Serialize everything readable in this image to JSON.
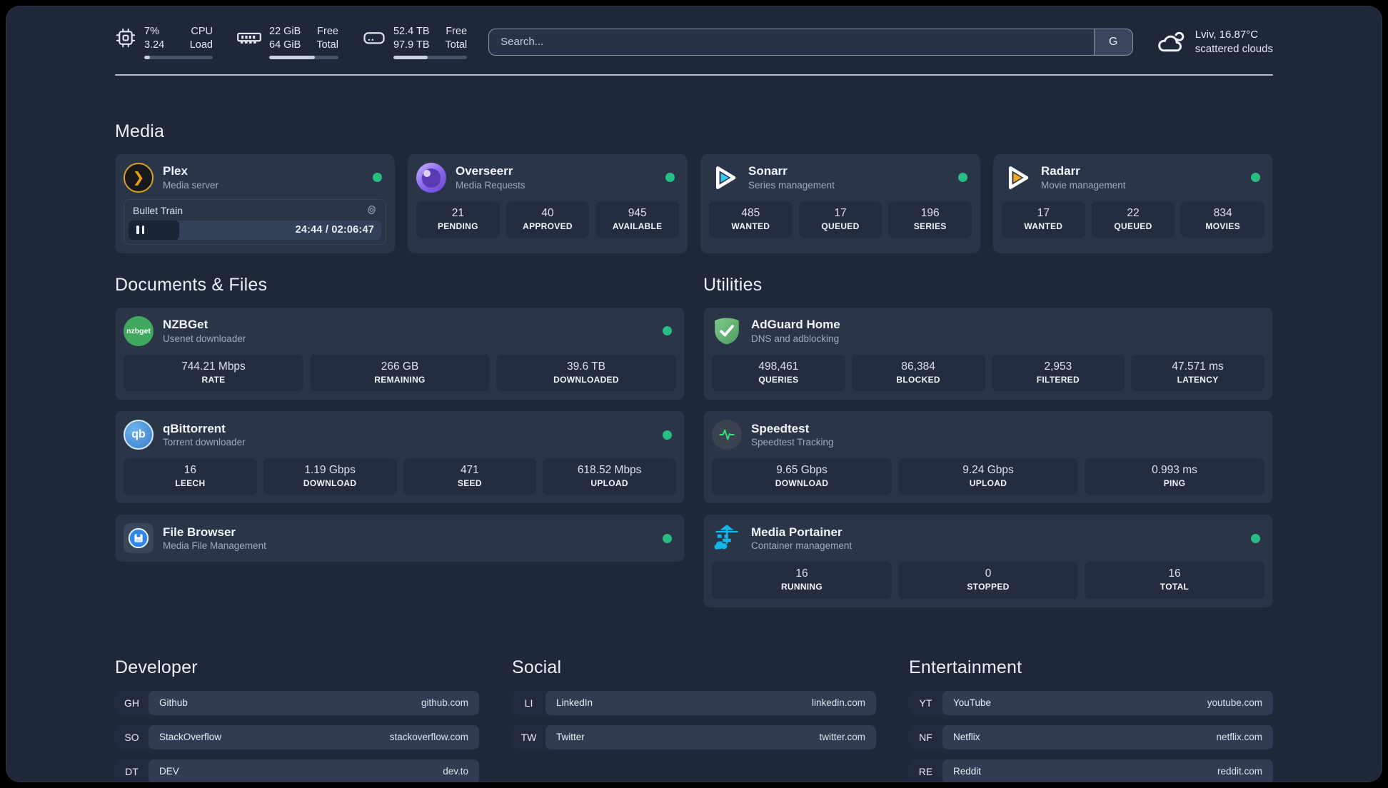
{
  "topbar": {
    "cpu": {
      "pct": "7%",
      "load": "3.24",
      "label_top": "CPU",
      "label_bottom": "Load",
      "progress": 8
    },
    "memory": {
      "free": "22 GiB",
      "total": "64 GiB",
      "label_top": "Free",
      "label_bottom": "Total",
      "progress": 66
    },
    "disk": {
      "free": "52.4 TB",
      "total": "97.9 TB",
      "label_top": "Free",
      "label_bottom": "Total",
      "progress": 47
    },
    "search": {
      "placeholder": "Search...",
      "button": "G"
    },
    "weather": {
      "line1": "Lviv, 16.87°C",
      "line2": "scattered clouds"
    }
  },
  "media": {
    "title": "Media",
    "plex": {
      "title": "Plex",
      "subtitle": "Media server",
      "now_playing": "Bullet Train",
      "time": "24:44 / 02:06:47",
      "progress": 20
    },
    "overseerr": {
      "title": "Overseerr",
      "subtitle": "Media Requests",
      "stats": [
        {
          "value": "21",
          "label": "PENDING"
        },
        {
          "value": "40",
          "label": "APPROVED"
        },
        {
          "value": "945",
          "label": "AVAILABLE"
        }
      ]
    },
    "sonarr": {
      "title": "Sonarr",
      "subtitle": "Series management",
      "stats": [
        {
          "value": "485",
          "label": "WANTED"
        },
        {
          "value": "17",
          "label": "QUEUED"
        },
        {
          "value": "196",
          "label": "SERIES"
        }
      ]
    },
    "radarr": {
      "title": "Radarr",
      "subtitle": "Movie management",
      "stats": [
        {
          "value": "17",
          "label": "WANTED"
        },
        {
          "value": "22",
          "label": "QUEUED"
        },
        {
          "value": "834",
          "label": "MOVIES"
        }
      ]
    }
  },
  "documents": {
    "title": "Documents & Files",
    "nzbget": {
      "title": "NZBGet",
      "subtitle": "Usenet downloader",
      "icon_text": "nzbget",
      "stats": [
        {
          "value": "744.21 Mbps",
          "label": "RATE"
        },
        {
          "value": "266 GB",
          "label": "REMAINING"
        },
        {
          "value": "39.6 TB",
          "label": "DOWNLOADED"
        }
      ]
    },
    "qbittorrent": {
      "title": "qBittorrent",
      "subtitle": "Torrent downloader",
      "icon_text": "qb",
      "stats": [
        {
          "value": "16",
          "label": "LEECH"
        },
        {
          "value": "1.19 Gbps",
          "label": "DOWNLOAD"
        },
        {
          "value": "471",
          "label": "SEED"
        },
        {
          "value": "618.52 Mbps",
          "label": "UPLOAD"
        }
      ]
    },
    "filebrowser": {
      "title": "File Browser",
      "subtitle": "Media File Management"
    }
  },
  "utilities": {
    "title": "Utilities",
    "adguard": {
      "title": "AdGuard Home",
      "subtitle": "DNS and adblocking",
      "stats": [
        {
          "value": "498,461",
          "label": "QUERIES"
        },
        {
          "value": "86,384",
          "label": "BLOCKED"
        },
        {
          "value": "2,953",
          "label": "FILTERED"
        },
        {
          "value": "47.571 ms",
          "label": "LATENCY"
        }
      ]
    },
    "speedtest": {
      "title": "Speedtest",
      "subtitle": "Speedtest Tracking",
      "stats": [
        {
          "value": "9.65 Gbps",
          "label": "DOWNLOAD"
        },
        {
          "value": "9.24 Gbps",
          "label": "UPLOAD"
        },
        {
          "value": "0.993 ms",
          "label": "PING"
        }
      ]
    },
    "portainer": {
      "title": "Media Portainer",
      "subtitle": "Container management",
      "stats": [
        {
          "value": "16",
          "label": "RUNNING"
        },
        {
          "value": "0",
          "label": "STOPPED"
        },
        {
          "value": "16",
          "label": "TOTAL"
        }
      ]
    }
  },
  "bookmarks": [
    {
      "title": "Developer",
      "items": [
        {
          "abbr": "GH",
          "name": "Github",
          "url": "github.com"
        },
        {
          "abbr": "SO",
          "name": "StackOverflow",
          "url": "stackoverflow.com"
        },
        {
          "abbr": "DT",
          "name": "DEV",
          "url": "dev.to"
        }
      ]
    },
    {
      "title": "Social",
      "items": [
        {
          "abbr": "LI",
          "name": "LinkedIn",
          "url": "linkedin.com"
        },
        {
          "abbr": "TW",
          "name": "Twitter",
          "url": "twitter.com"
        }
      ]
    },
    {
      "title": "Entertainment",
      "items": [
        {
          "abbr": "YT",
          "name": "YouTube",
          "url": "youtube.com"
        },
        {
          "abbr": "NF",
          "name": "Netflix",
          "url": "netflix.com"
        },
        {
          "abbr": "RE",
          "name": "Reddit",
          "url": "reddit.com"
        }
      ]
    }
  ],
  "colors": {
    "accent_green": "#27bd83",
    "plex_gold": "#e5a00d",
    "sonarr_blue": "#35c5f4",
    "radarr_gold": "#f7a821",
    "portainer_blue": "#13b5ea"
  }
}
